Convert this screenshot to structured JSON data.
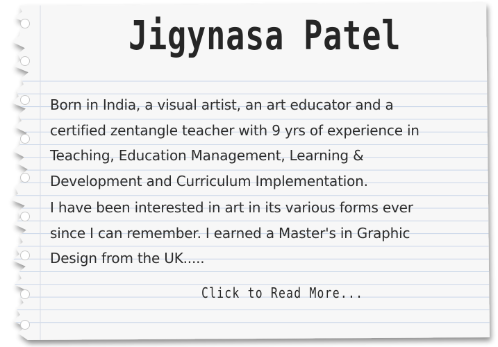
{
  "card": {
    "title": "Jigynasa Patel",
    "paragraph_1_lines": [
      "Born in India, a visual artist, an art educator and a",
      "certified zentangle teacher with 9 yrs of experience in",
      "Teaching, Education Management, Learning &",
      "Development and Curriculum Implementation."
    ],
    "paragraph_2_lines": [
      "I have been interested in art in its various forms ever",
      "since I can remember. I earned a Master's in Graphic",
      "Design from the UK....."
    ],
    "read_more_label": "Click to Read More..."
  },
  "colors": {
    "paper": "#f7f7f7",
    "ruled_line": "#c9d6e8",
    "margin_line": "#d7dbe6",
    "ink": "#2b2b2b"
  }
}
